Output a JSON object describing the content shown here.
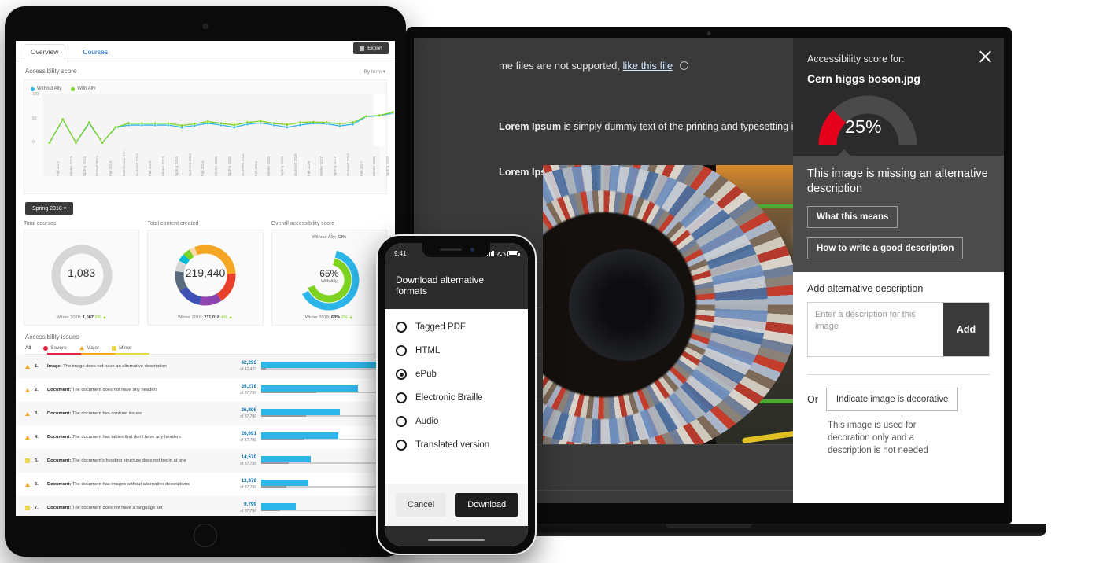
{
  "laptop": {
    "notice": "me files are not supported,",
    "notice_link": "like this file",
    "paragraph1": "Lorem Ipsum is simply dummy text of the printing and typesetting industry. Lorem Ipsum has been the industry's standard dummy text ever since the 1500s, when an unknown printer took a galley of type and scrambled it to make a type specimen book. It has survived not only five centuries, but also the leap into electronic typesetting, remaining essentially unchanged. It was popularised in the 1960s with the release of Letraset sheets containing Lorem Ipsum passages, and more recently with desktop publishing software like Aldus PageMaker.",
    "paragraph2": "Lorem Ipsum is simply dummy text of the printing and typesetting industry. Lorem Ipsum has been the industry's standard dummy text ever since the 1500s, when an unknown printer took a galley of type and scrambled it to make a type specimen book. It has survived not only five centuries, but also the leap into electronic typesetting, remaining essentially unchanged. It was popularised in the 1960s."
  },
  "a11y_panel": {
    "label": "Accessibility score for:",
    "filename": "Cern higgs boson.jpg",
    "close_icon": "close-icon",
    "score_percent": "25%",
    "score_value": 25,
    "gauge_color": "#e4011b",
    "gauge_track_color": "#4a4a4a",
    "message": "This image is missing an alternative description",
    "btn_what": "What this means",
    "btn_how": "How to write a good description",
    "add_heading": "Add alternative description",
    "input_placeholder": "Enter a description for this image",
    "input_value": "",
    "add_button": "Add",
    "or_label": "Or",
    "decorative_button": "Indicate image is decorative",
    "decorative_note": "This image is used for decoration only and a description is not needed"
  },
  "phone": {
    "status_time": "9:41",
    "status_icons": [
      "signal-icon",
      "wifi-icon",
      "battery-icon"
    ],
    "title": "Download alternative formats",
    "options": [
      {
        "label": "Tagged PDF",
        "selected": false
      },
      {
        "label": "HTML",
        "selected": false
      },
      {
        "label": "ePub",
        "selected": true
      },
      {
        "label": "Electronic Braille",
        "selected": false
      },
      {
        "label": "Audio",
        "selected": false
      },
      {
        "label": "Translated version",
        "selected": false
      }
    ],
    "cancel_label": "Cancel",
    "download_label": "Download"
  },
  "dashboard": {
    "tabs": [
      {
        "label": "Overview",
        "active": true
      },
      {
        "label": "Courses",
        "active": false
      }
    ],
    "export_label": "Export",
    "section_title": "Accessibility score",
    "section_filter": "By term",
    "term_pill": "Spring 2018",
    "kpis": [
      {
        "title": "Total courses",
        "value": "1,083",
        "footer_prefix": "Winter 2018:",
        "footer_value": "1,087",
        "footer_delta": "2%",
        "footer_dir": "▲"
      },
      {
        "title": "Total content created",
        "value": "219,440",
        "footer_prefix": "Winter 2018:",
        "footer_value": "211,018",
        "footer_delta": "4%",
        "footer_dir": "▲"
      },
      {
        "title": "Overall accessibility score",
        "value": "65%",
        "value_sub": "With Ally",
        "top_label_prefix": "Without Ally:",
        "top_label_value": "63%",
        "footer_prefix": "Winter 2018:",
        "footer_value": "63%",
        "footer_delta": "2%",
        "footer_dir": "▲"
      }
    ],
    "issues_title": "Accessibility issues",
    "issue_tabs": [
      {
        "label": "All",
        "icon": "none",
        "active": true
      },
      {
        "label": "Severe",
        "icon": "severe-dot-icon",
        "active": false
      },
      {
        "label": "Major",
        "icon": "major-triangle-icon",
        "active": false
      },
      {
        "label": "Minor",
        "icon": "minor-flag-icon",
        "active": false
      }
    ],
    "issues": [
      {
        "num": "1.",
        "sev": "major",
        "type": "Image:",
        "text": " The image does not have an alternative description",
        "count": "42,293",
        "of": "of 42,432",
        "pct": 99,
        "under": 4
      },
      {
        "num": "2.",
        "sev": "major",
        "type": "Document:",
        "text": " The document does not have any headers",
        "count": "35,278",
        "of": "of 87,799",
        "pct": 78,
        "under": 44
      },
      {
        "num": "3.",
        "sev": "major",
        "type": "Document:",
        "text": " The document has contrast issues",
        "count": "26,806",
        "of": "of 87,799",
        "pct": 63,
        "under": 36
      },
      {
        "num": "4.",
        "sev": "major",
        "type": "Document:",
        "text": " The document has tables that don't have any headers",
        "count": "26,691",
        "of": "of 87,799",
        "pct": 62,
        "under": 35
      },
      {
        "num": "5.",
        "sev": "minor",
        "type": "Document:",
        "text": " The document's heading structure does not begin at one",
        "count": "14,570",
        "of": "of 87,799",
        "pct": 40,
        "under": 22
      },
      {
        "num": "6.",
        "sev": "major",
        "type": "Document:",
        "text": " The document has images without alternative descriptions",
        "count": "13,978",
        "of": "of 87,799",
        "pct": 38,
        "under": 20
      },
      {
        "num": "7.",
        "sev": "minor",
        "type": "Document:",
        "text": " The document does not have a language set",
        "count": "9,799",
        "of": "of 87,799",
        "pct": 28,
        "under": 15
      }
    ]
  },
  "chart_data": {
    "type": "line",
    "title": "Accessibility score",
    "legend": [
      {
        "name": "Without Ally",
        "color": "#2cb5e8"
      },
      {
        "name": "With Ally",
        "color": "#7ed321"
      }
    ],
    "legend_position": "top-left",
    "ylabel": "",
    "xlabel": "",
    "ylim": [
      0,
      100
    ],
    "yticks": [
      0,
      50,
      100
    ],
    "grid": false,
    "categories": [
      "Fall 2012",
      "Winter 2013",
      "Spring 2013",
      "Default Term",
      "Fall 2013",
      "Continuous Enr...",
      "Summer 2013",
      "Fall 2013",
      "Winter 2014",
      "Spring 2014",
      "Summer 2014",
      "Fall 2014",
      "Winter 2015",
      "Spring 2015",
      "Summer 2015",
      "Fall 2015",
      "Winter 2016",
      "Spring 2016",
      "Summer 2016",
      "Fall 2016",
      "Winter 2017",
      "Spring 2017",
      "Summer 2017",
      "Fall 2017",
      "Winter 2018",
      "Spring 2018",
      "Summer 2018"
    ],
    "series": [
      {
        "name": "Without Ally",
        "color": "#2cb5e8",
        "values": [
          1,
          53,
          1,
          45,
          1,
          35,
          41,
          41,
          41,
          41,
          36,
          40,
          45,
          41,
          36,
          43,
          46,
          41,
          36,
          41,
          45,
          44,
          39,
          43,
          60,
          62,
          68
        ]
      },
      {
        "name": "With Ally",
        "color": "#7ed321",
        "values": [
          1,
          54,
          1,
          47,
          1,
          36,
          45,
          45,
          45,
          45,
          40,
          44,
          49,
          45,
          41,
          47,
          50,
          45,
          42,
          47,
          48,
          47,
          44,
          47,
          61,
          63,
          70
        ]
      }
    ],
    "highlight_category": "Spring 2018"
  },
  "content_donut": {
    "type": "pie",
    "title": "Total content created",
    "center_label": "219,440",
    "slices": [
      {
        "label": "slice-1",
        "value": 24,
        "color": "#f5a623"
      },
      {
        "label": "slice-2",
        "value": 17,
        "color": "#e8402a"
      },
      {
        "label": "slice-3",
        "value": 12,
        "color": "#8e44ad"
      },
      {
        "label": "slice-4",
        "value": 13,
        "color": "#3f51b5"
      },
      {
        "label": "slice-5",
        "value": 11,
        "color": "#5a6b7d"
      },
      {
        "label": "slice-6",
        "value": 6,
        "color": "#d6d6d6"
      },
      {
        "label": "slice-7",
        "value": 4,
        "color": "#00bcd4"
      },
      {
        "label": "slice-8",
        "value": 4,
        "color": "#7ed321"
      },
      {
        "label": "slice-9",
        "value": 3,
        "color": "#f8d9b0"
      },
      {
        "label": "slice-10",
        "value": 6,
        "color": "#f5a623"
      }
    ]
  },
  "score_donut": {
    "type": "pie",
    "title": "Overall accessibility score",
    "outer_value": 63,
    "outer_color": "#2cb5e8",
    "inner_value": 65,
    "inner_color": "#7ed321",
    "center_label": "65%",
    "center_sub": "With Ally"
  },
  "courses_donut": {
    "type": "pie",
    "title": "Total courses",
    "center_label": "1,083",
    "color": "#d6d6d6"
  }
}
